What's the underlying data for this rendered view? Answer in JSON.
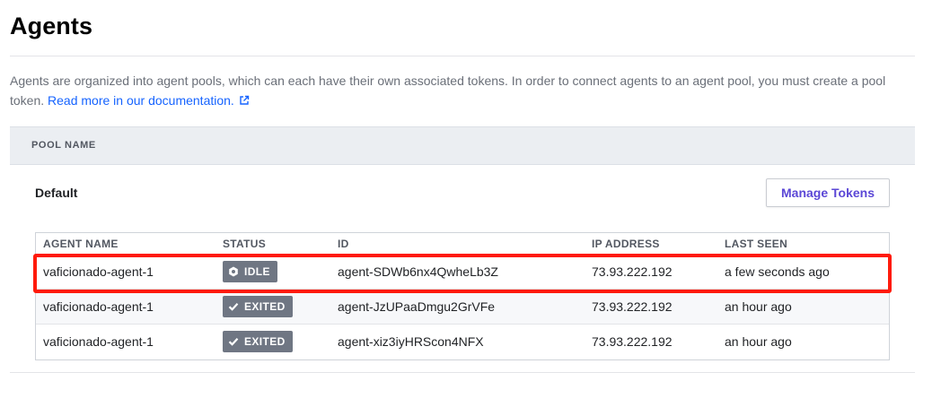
{
  "page": {
    "title": "Agents",
    "intro_text": "Agents are organized into agent pools, which can each have their own associated tokens. In order to connect agents to an agent pool, you must create a pool token.",
    "doc_link_label": "Read more in our documentation."
  },
  "pool_table": {
    "header": "POOL NAME",
    "pool_name": "Default",
    "manage_tokens_label": "Manage Tokens"
  },
  "agents_table": {
    "columns": [
      "AGENT NAME",
      "STATUS",
      "ID",
      "IP ADDRESS",
      "LAST SEEN"
    ],
    "rows": [
      {
        "name": "vaficionado-agent-1",
        "status": "IDLE",
        "status_icon": "hexagon-icon",
        "id": "agent-SDWb6nx4QwheLb3Z",
        "ip": "73.93.222.192",
        "last_seen": "a few seconds ago",
        "highlighted": true
      },
      {
        "name": "vaficionado-agent-1",
        "status": "EXITED",
        "status_icon": "check-icon",
        "id": "agent-JzUPaaDmgu2GrVFe",
        "ip": "73.93.222.192",
        "last_seen": "an hour ago"
      },
      {
        "name": "vaficionado-agent-1",
        "status": "EXITED",
        "status_icon": "check-icon",
        "id": "agent-xiz3iyHRScon4NFX",
        "ip": "73.93.222.192",
        "last_seen": "an hour ago"
      }
    ]
  },
  "colors": {
    "link": "#1563ff",
    "manage_button_text": "#5b47d6",
    "badge_background": "#6f7683",
    "highlight_border": "#ff1a0a",
    "pool_header_background": "#ebeef2"
  }
}
